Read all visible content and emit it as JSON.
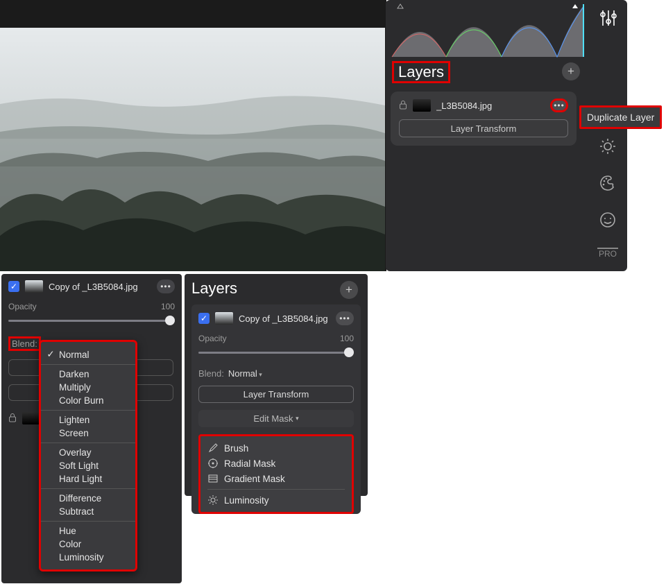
{
  "colors": {
    "accent_red": "#e00000",
    "checkbox_blue": "#3a6ff0"
  },
  "preview_image_alt": "Misty layered forest landscape",
  "histogram": {
    "triangle_warning_left": true,
    "triangle_warning_right": true
  },
  "top_panel": {
    "title": "Layers",
    "add_label": "+",
    "layer": {
      "locked": true,
      "name": "_L3B5084.jpg",
      "ellipsis": "•••",
      "transform_btn": "Layer Transform"
    }
  },
  "side_tools": {
    "layers_icon": "layers",
    "adjustments_icon": "sliders",
    "brightness_icon": "brightness",
    "palette_icon": "palette",
    "face_icon": "face",
    "pro_label": "PRO"
  },
  "tooltip_text": "Duplicate Layer",
  "panelA": {
    "layer_name": "Copy of _L3B5084.jpg",
    "ellipsis": "•••",
    "opacity_label": "Opacity",
    "opacity_value": "100",
    "blend_label": "Blend:",
    "blend_value": "Normal"
  },
  "blend_modes": {
    "groups": [
      [
        {
          "label": "Normal",
          "checked": true
        }
      ],
      [
        {
          "label": "Darken"
        },
        {
          "label": "Multiply"
        },
        {
          "label": "Color Burn"
        }
      ],
      [
        {
          "label": "Lighten"
        },
        {
          "label": "Screen"
        }
      ],
      [
        {
          "label": "Overlay"
        },
        {
          "label": "Soft Light"
        },
        {
          "label": "Hard Light"
        }
      ],
      [
        {
          "label": "Difference"
        },
        {
          "label": "Subtract"
        }
      ],
      [
        {
          "label": "Hue"
        },
        {
          "label": "Color"
        },
        {
          "label": "Luminosity"
        }
      ]
    ]
  },
  "panelB": {
    "title": "Layers",
    "add_label": "+",
    "card": {
      "layer_name": "Copy of _L3B5084.jpg",
      "ellipsis": "•••",
      "opacity_label": "Opacity",
      "opacity_value": "100",
      "blend_label": "Blend:",
      "blend_value": "Normal",
      "transform_btn": "Layer Transform",
      "edit_mask_btn": "Edit Mask",
      "mask_items": [
        "Brush",
        "Radial Mask",
        "Gradient Mask"
      ],
      "mask_luminosity": "Luminosity"
    }
  }
}
